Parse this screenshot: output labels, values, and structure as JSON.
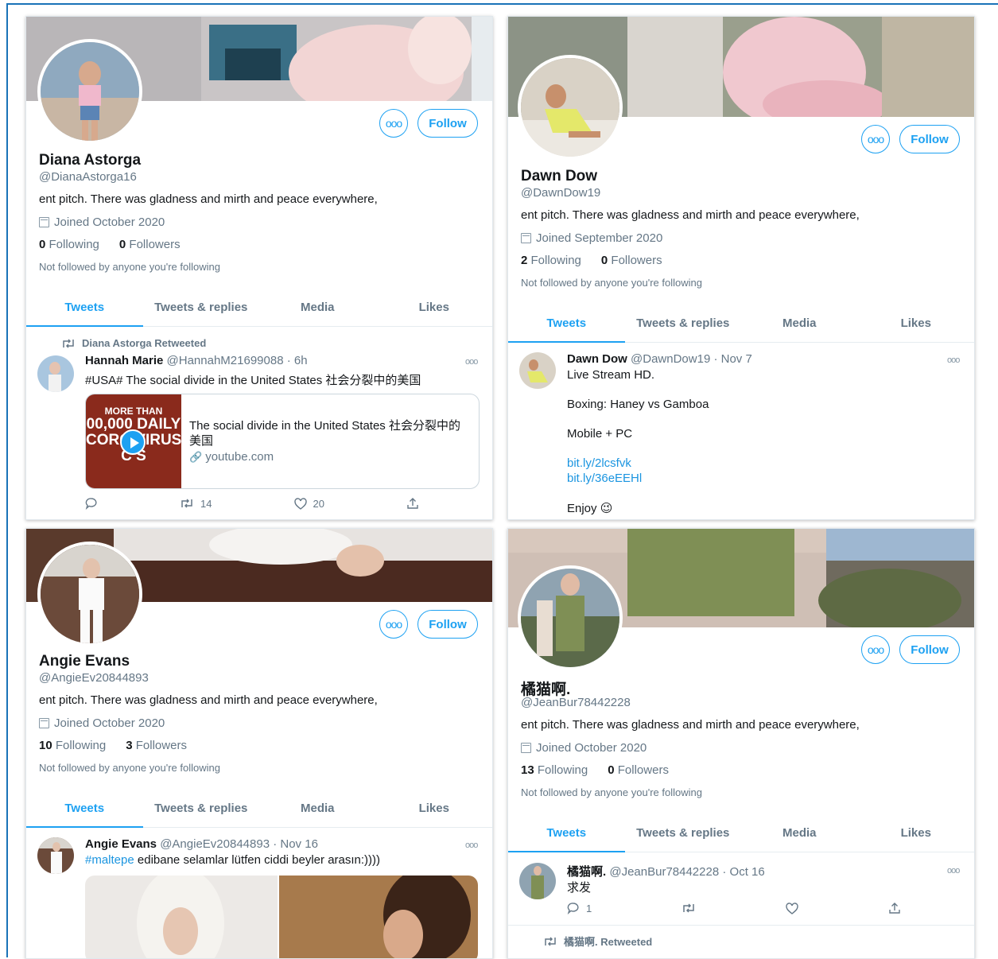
{
  "common": {
    "more_glyph": "ooo",
    "follow_label": "Follow",
    "bio": "ent pitch. There was gladness and mirth and peace everywhere,",
    "not_followed": "Not followed by anyone you're following",
    "following_label": "Following",
    "followers_label": "Followers",
    "tabs": [
      "Tweets",
      "Tweets & replies",
      "Media",
      "Likes"
    ],
    "accent": "#1da1f2"
  },
  "profiles": [
    {
      "name": "Diana Astorga",
      "handle": "@DianaAstorga16",
      "joined": "Joined October 2020",
      "following": "0",
      "followers": "0",
      "tweet": {
        "retweet_label": "Diana Astorga Retweeted",
        "author": "Hannah Marie",
        "author_handle": "@HannahM21699088",
        "time": "· 6h",
        "text": "#USA#  The social divide in the United States 社会分裂中的美国",
        "card_title_1": "The social divide in the United States 社会分裂中的",
        "card_title_2": "美国",
        "card_domain": "youtube.com",
        "thumb_line1": "MORE THAN",
        "thumb_line2": "00,000 DAILY",
        "thumb_line3": "CORO  VIRUS",
        "thumb_line4": "C  S",
        "retweets": "14",
        "likes": "20"
      }
    },
    {
      "name": "Dawn Dow",
      "handle": "@DawnDow19",
      "joined": "Joined September 2020",
      "following": "2",
      "followers": "0",
      "tweet": {
        "author": "Dawn Dow",
        "author_handle": "@DawnDow19",
        "time": "· Nov 7",
        "line1": "Live Stream HD.",
        "line2": "Boxing: Haney vs Gamboa",
        "line3": "Mobile + PC",
        "link1": "bit.ly/2lcsfvk",
        "link2": "bit.ly/36eEEHl",
        "line4": "Enjoy",
        "emoji": "😉"
      }
    },
    {
      "name": "Angie Evans",
      "handle": "@AngieEv20844893",
      "joined": "Joined October 2020",
      "following": "10",
      "followers": "3",
      "tweet": {
        "author": "Angie Evans",
        "author_handle": "@AngieEv20844893",
        "time": "· Nov 16",
        "hashtag": "#maltepe",
        "text": " edibane selamlar lütfen ciddi beyler arasın:))))"
      }
    },
    {
      "name": "橘猫啊.",
      "handle": "@JeanBur78442228",
      "joined": "Joined October 2020",
      "following": "13",
      "followers": "0",
      "tweet": {
        "author": "橘猫啊.",
        "author_handle": "@JeanBur78442228",
        "time": "· Oct 16",
        "text": "求发",
        "replies": "1",
        "retweet_label": "橘猫啊. Retweeted"
      }
    }
  ]
}
